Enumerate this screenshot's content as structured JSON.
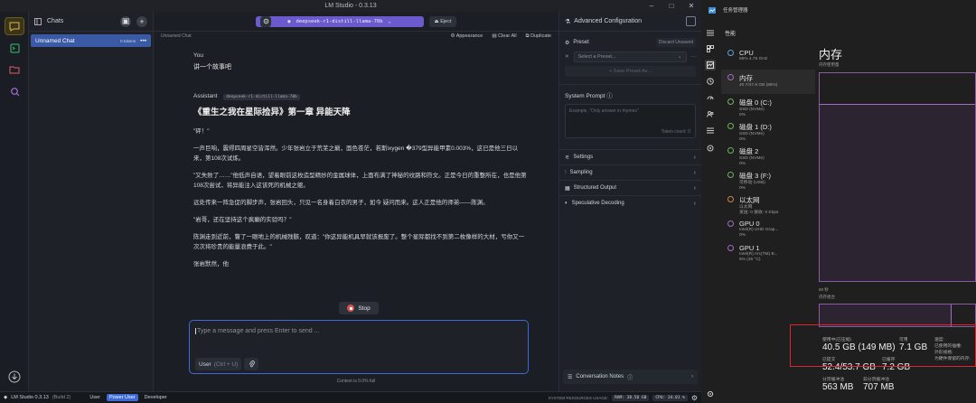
{
  "lm_window": {
    "title": "LM Studio - 0.3.13",
    "chats_header": "Chats",
    "chat_item": {
      "name": "Unnamed Chat",
      "tokens": "0 tokens"
    },
    "model_pill": "deepseek-r1-distill-llama-70b",
    "eject_label": "Eject",
    "breadcrumb": "Unnamed Chat",
    "actions": {
      "appearance": "Appearance",
      "clear_all": "Clear All",
      "duplicate": "Duplicate"
    },
    "user_role": "You",
    "user_message": "讲一个故事吧",
    "assistant_role": "Assistant",
    "assistant_model_tag": "deepseek-r1-distill-llama-70b",
    "story_title": "《重生之我在星际捡异》第一章 异能天降",
    "paragraphs": [
      "\"砰！\"",
      "一声巨响，震得四周星空皆浑然。少年张岩立于荒芜之巅，面色苍茫，若斯ixygen �379型异能甲素0.003%，这已是他三日以来，第108次试炼。",
      "\"又失败了……\"他低声自语，望着眼前这枚造型精妙的金属球体，上面布满了神秘的纹路和符文。正是今日的重整所在，也是他第108次尝试，将异能注入这该死的机械之躯。",
      "远处传来一阵急促的脚步声，张岩回头，只见一名身着白衣的男子，如今 疑问而来。这人正是他的师弟——陈渊。",
      "\"岩哥，还在坚持这个疯癫的实验吗？\"",
      "陈渊走到近前，瞥了一眼地上的机械残骸，叹道：\"你这异能机具早就该报废了。整个星际都找不到第二枚像样的大材，亏你又一次次将珍贵的能量浪费于此。\"",
      "张岩默然，他"
    ],
    "stop_label": "Stop",
    "input_placeholder": "Type a message and press Enter to send ...",
    "role_selector": "User",
    "role_shortcut": "(Ctrl + U)",
    "context_status": "Context is 0.0% full",
    "right_panel": {
      "title": "Advanced Configuration",
      "preset_label": "Preset",
      "discard": "Discard Unsaved",
      "select_preset": "Select a Preset...",
      "save_preset": "+ Save Preset As...",
      "system_prompt_label": "System Prompt",
      "system_prompt_placeholder": "Example, \"Only answer in rhymes\"",
      "token_count": "Token count: 0",
      "sections": [
        "Settings",
        "Sampling",
        "Structured Output",
        "Speculative Decoding"
      ],
      "notes": "Conversation Notes"
    },
    "statusbar": {
      "app": "LM Studio 0.3.13",
      "build": "(Build 2)",
      "modes": [
        "User",
        "Power User",
        "Developer"
      ],
      "active_mode": "Power User",
      "resources_label": "SYSTEM RESOURCES USAGE:",
      "ram": "RAM: 38.50 GB",
      "cpu": "CPU: 34.01 %"
    }
  },
  "task_manager": {
    "title": "任务管理器",
    "section": "性能",
    "items": [
      {
        "name": "CPU",
        "sub1": "55% 4.75 GHz",
        "sub2": ""
      },
      {
        "name": "内存",
        "sub1": "40.7/47.8 GB (85%)",
        "sub2": ""
      },
      {
        "name": "磁盘 0 (C:)",
        "sub1": "SSD (NVMe)",
        "sub2": "0%"
      },
      {
        "name": "磁盘 1 (D:)",
        "sub1": "SSD (NVMe)",
        "sub2": "0%"
      },
      {
        "name": "磁盘 2",
        "sub1": "SSD (NVMe)",
        "sub2": "0%"
      },
      {
        "name": "磁盘 3 (F:)",
        "sub1": "可移动 (USB)",
        "sub2": "0%"
      },
      {
        "name": "以太网",
        "sub1": "以太网",
        "sub2": "发送: 0 接收: 0 Kbps"
      },
      {
        "name": "GPU 0",
        "sub1": "Intel(R) UHD Grap...",
        "sub2": "0%"
      },
      {
        "name": "GPU 1",
        "sub1": "Intel(R) Arc(TM) B...",
        "sub2": "6% (45 °C)"
      }
    ],
    "detail_title": "内存",
    "usage_label": "内存使用量",
    "seconds_label": "60 秒",
    "composition_label": "内存组合",
    "stats": {
      "in_use_label": "使用中(已压缩)",
      "in_use": "40.5 GB (149 MB)",
      "available_label": "可用",
      "available": "7.1 GB",
      "speed_label": "速度:",
      "slots_label": "已使用的插槽:",
      "form_label": "外形规格:",
      "reserved_label": "为硬件保留的内存:",
      "committed_label": "已提交",
      "committed": "52.4/53.7 GB",
      "cached_label": "已缓存",
      "cached": "7.2 GB",
      "paged_label": "分页缓冲池",
      "paged": "563 MB",
      "nonpaged_label": "非分页缓冲池",
      "nonpaged": "707 MB"
    },
    "memory_percent": 85
  },
  "colors": {
    "accent_blue": "#3d6ad6",
    "model_purple": "#6a5acd",
    "chat_highlight": "#3a5aa5",
    "memory_purple": "#a36cc4",
    "highlight_red": "#e0262b"
  }
}
